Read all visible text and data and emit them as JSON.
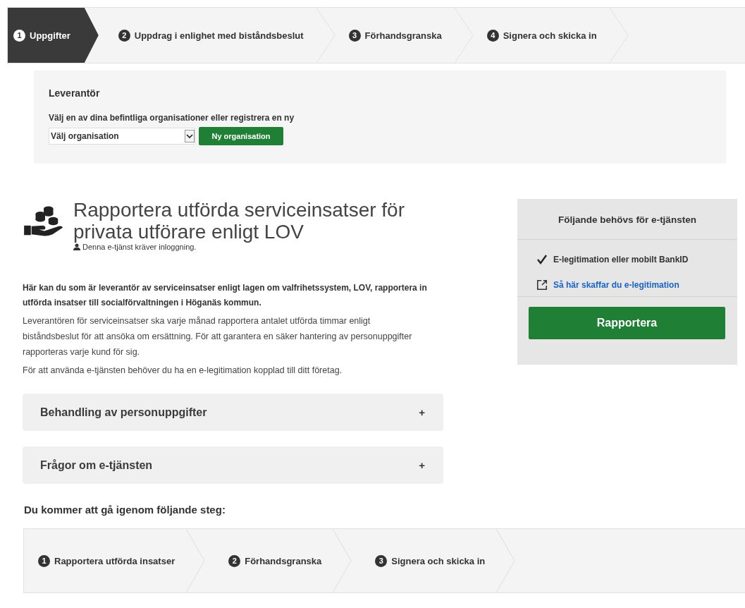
{
  "top_steps": [
    {
      "number": "1",
      "label": "Uppgifter",
      "selected": true
    },
    {
      "number": "2",
      "label": "Uppdrag i enlighet med biståndsbeslut",
      "selected": false
    },
    {
      "number": "3",
      "label": "Förhandsgranska",
      "selected": false
    },
    {
      "number": "4",
      "label": "Signera och skicka in",
      "selected": false
    }
  ],
  "supplier": {
    "title": "Leverantör",
    "instruction": "Välj en av dina befintliga organisationer eller registrera en ny",
    "select_value": "Välj organisation",
    "button": "Ny organisation"
  },
  "service": {
    "title": "Rapportera utförda serviceinsatser för privata utförare enligt LOV",
    "login_note": "Denna e-tjänst kräver inloggning.",
    "intro": "Här kan du som är leverantör av serviceinsatser enligt lagen om valfrihetssystem, LOV, rapportera in utförda insatser till socialförvaltningen i Höganäs kommun.",
    "paragraphs": [
      "Leverantören för serviceinsatser ska varje månad rapportera antalet utförda timmar enligt biståndsbeslut för att ansöka om ersättning. För att garantera en säker hantering av personuppgifter rapporteras varje kund för sig.",
      "För att använda e-tjänsten behöver du ha en e-legitimation kopplad till ditt företag."
    ]
  },
  "accordions": [
    {
      "title": "Behandling av personuppgifter",
      "toggle": "+",
      "expanded": false
    },
    {
      "title": "Frågor om e-tjänsten",
      "toggle": "+",
      "expanded": false
    }
  ],
  "steps_heading": "Du kommer att gå igenom följande steg:",
  "bottom_steps": [
    {
      "number": "1",
      "label": "Rapportera utförda insatser"
    },
    {
      "number": "2",
      "label": "Förhandsgranska"
    },
    {
      "number": "3",
      "label": "Signera och skicka in"
    }
  ],
  "requirements": {
    "title": "Följande behövs för e-tjänsten",
    "items": [
      {
        "kind": "check",
        "text": "E-legitimation eller mobilt BankID"
      },
      {
        "kind": "link",
        "text": "Så här skaffar du e-legitimation"
      }
    ],
    "button": "Rapportera"
  }
}
